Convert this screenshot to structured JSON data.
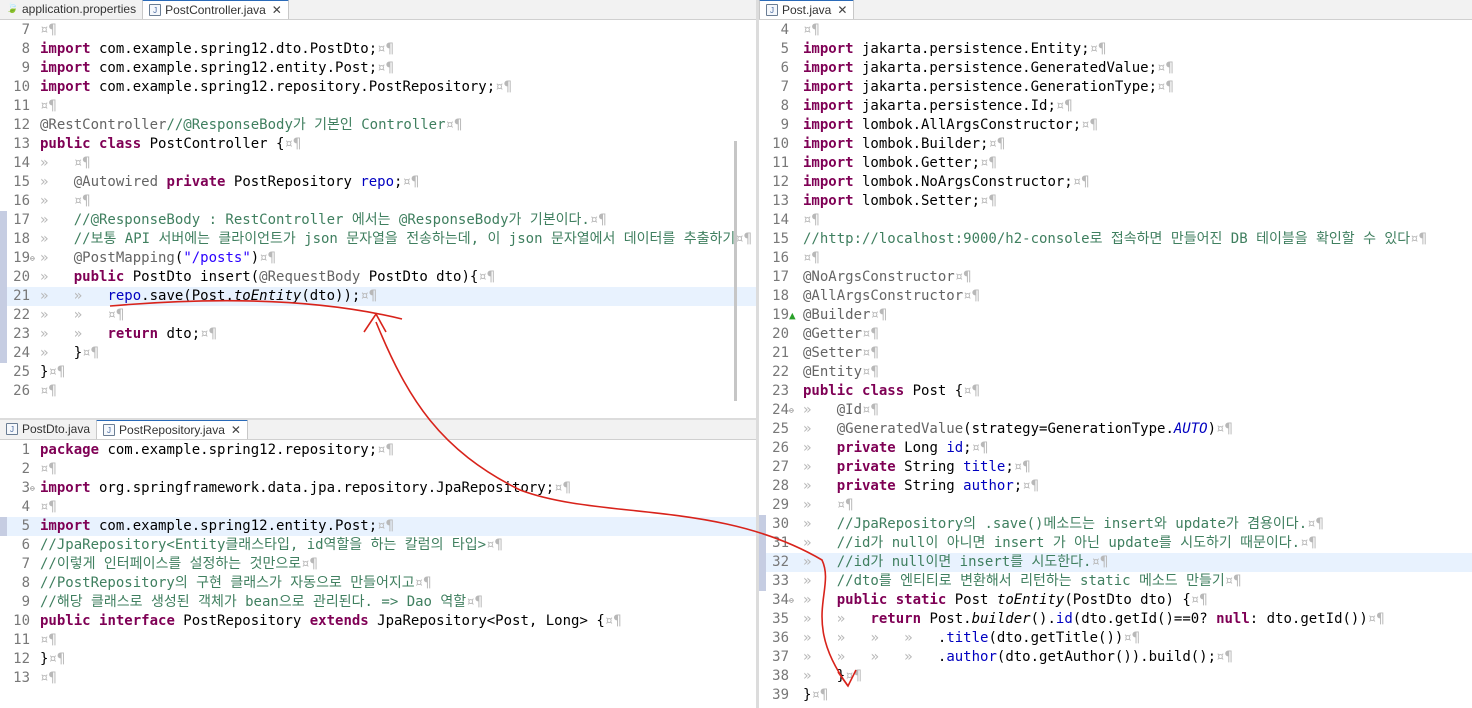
{
  "panes": {
    "top_left": {
      "tabs": [
        {
          "label": "application.properties",
          "active": false
        },
        {
          "label": "PostController.java",
          "active": true
        }
      ]
    },
    "bottom_left": {
      "tabs": [
        {
          "label": "PostDto.java",
          "active": false
        },
        {
          "label": "PostRepository.java",
          "active": true
        }
      ]
    },
    "right": {
      "tabs": [
        {
          "label": "Post.java",
          "active": true
        }
      ]
    }
  },
  "code": {
    "post_controller": [
      {
        "n": "7",
        "t": ""
      },
      {
        "n": "8",
        "t": "import com.example.spring12.dto.PostDto;"
      },
      {
        "n": "9",
        "t": "import com.example.spring12.entity.Post;"
      },
      {
        "n": "10",
        "t": "import com.example.spring12.repository.PostRepository;"
      },
      {
        "n": "11",
        "t": ""
      },
      {
        "n": "12",
        "t": "@RestController//@ResponseBody가 기본인 Controller"
      },
      {
        "n": "13",
        "t": "public class PostController {"
      },
      {
        "n": "14",
        "t": "\t"
      },
      {
        "n": "15",
        "t": "\t@Autowired private PostRepository repo;"
      },
      {
        "n": "16",
        "t": "\t"
      },
      {
        "n": "17",
        "t": "\t//@ResponseBody : RestController 에서는 @ResponseBody가 기본이다."
      },
      {
        "n": "18",
        "t": "\t//보통 API 서버에는 클라이언트가 json 문자열을 전송하는데, 이 json 문자열에서 데이터를 추출하기"
      },
      {
        "n": "19",
        "t": "\t@PostMapping(\"/posts\")"
      },
      {
        "n": "20",
        "t": "\tpublic PostDto insert(@RequestBody PostDto dto){"
      },
      {
        "n": "21",
        "t": "\t\trepo.save(Post.toEntity(dto));"
      },
      {
        "n": "22",
        "t": "\t\t"
      },
      {
        "n": "23",
        "t": "\t\treturn dto;"
      },
      {
        "n": "24",
        "t": "\t}"
      },
      {
        "n": "25",
        "t": "}"
      },
      {
        "n": "26",
        "t": ""
      }
    ],
    "post_repository": [
      {
        "n": "1",
        "t": "package com.example.spring12.repository;"
      },
      {
        "n": "2",
        "t": ""
      },
      {
        "n": "3",
        "t": "import org.springframework.data.jpa.repository.JpaRepository;"
      },
      {
        "n": "4",
        "t": ""
      },
      {
        "n": "5",
        "t": "import com.example.spring12.entity.Post;"
      },
      {
        "n": "6",
        "t": "//JpaRepository<Entity클래스타입, id역할을 하는 칼럼의 타입>"
      },
      {
        "n": "7",
        "t": "//이렇게 인터페이스를 설정하는 것만으로"
      },
      {
        "n": "8",
        "t": "//PostRepository의 구현 클래스가 자동으로 만들어지고"
      },
      {
        "n": "9",
        "t": "//해당 클래스로 생성된 객체가 bean으로 관리된다. => Dao 역할"
      },
      {
        "n": "10",
        "t": "public interface PostRepository extends JpaRepository<Post, Long> {"
      },
      {
        "n": "11",
        "t": ""
      },
      {
        "n": "12",
        "t": "}"
      },
      {
        "n": "13",
        "t": ""
      }
    ],
    "post_entity": [
      {
        "n": "4",
        "t": ""
      },
      {
        "n": "5",
        "t": "import jakarta.persistence.Entity;"
      },
      {
        "n": "6",
        "t": "import jakarta.persistence.GeneratedValue;"
      },
      {
        "n": "7",
        "t": "import jakarta.persistence.GenerationType;"
      },
      {
        "n": "8",
        "t": "import jakarta.persistence.Id;"
      },
      {
        "n": "9",
        "t": "import lombok.AllArgsConstructor;"
      },
      {
        "n": "10",
        "t": "import lombok.Builder;"
      },
      {
        "n": "11",
        "t": "import lombok.Getter;"
      },
      {
        "n": "12",
        "t": "import lombok.NoArgsConstructor;"
      },
      {
        "n": "13",
        "t": "import lombok.Setter;"
      },
      {
        "n": "14",
        "t": ""
      },
      {
        "n": "15",
        "t": "//http://localhost:9000/h2-console로 접속하면 만들어진 DB 테이블을 확인할 수 있다"
      },
      {
        "n": "16",
        "t": ""
      },
      {
        "n": "17",
        "t": "@NoArgsConstructor"
      },
      {
        "n": "18",
        "t": "@AllArgsConstructor"
      },
      {
        "n": "19",
        "t": "@Builder"
      },
      {
        "n": "20",
        "t": "@Getter"
      },
      {
        "n": "21",
        "t": "@Setter"
      },
      {
        "n": "22",
        "t": "@Entity"
      },
      {
        "n": "23",
        "t": "public class Post {"
      },
      {
        "n": "24",
        "t": "\t@Id"
      },
      {
        "n": "25",
        "t": "\t@GeneratedValue(strategy=GenerationType.AUTO)"
      },
      {
        "n": "26",
        "t": "\tprivate Long id;"
      },
      {
        "n": "27",
        "t": "\tprivate String title;"
      },
      {
        "n": "28",
        "t": "\tprivate String author;"
      },
      {
        "n": "29",
        "t": "\t"
      },
      {
        "n": "30",
        "t": "\t//JpaRepository의 .save()메소드는 insert와 update가 겸용이다."
      },
      {
        "n": "31",
        "t": "\t//id가 null이 아니면 insert 가 아닌 update를 시도하기 때문이다."
      },
      {
        "n": "32",
        "t": "\t//id가 null이면 insert를 시도한다."
      },
      {
        "n": "33",
        "t": "\t//dto를 엔티티로 변환해서 리턴하는 static 메소드 만들기"
      },
      {
        "n": "34",
        "t": "\tpublic static Post toEntity(PostDto dto) {"
      },
      {
        "n": "35",
        "t": "\t\treturn Post.builder().id(dto.getId()==0? null: dto.getId())"
      },
      {
        "n": "36",
        "t": "\t\t\t\t.title(dto.getTitle())"
      },
      {
        "n": "37",
        "t": "\t\t\t\t.author(dto.getAuthor()).build();"
      },
      {
        "n": "38",
        "t": "\t}"
      },
      {
        "n": "39",
        "t": "}"
      }
    ]
  },
  "colors": {
    "keyword": "#7f0055",
    "comment": "#3f7f5f",
    "string": "#2a00ff",
    "field": "#0000c0",
    "annotation": "#646464",
    "current_line": "#e8f2fe",
    "pen_annotation": "#d8231b"
  }
}
